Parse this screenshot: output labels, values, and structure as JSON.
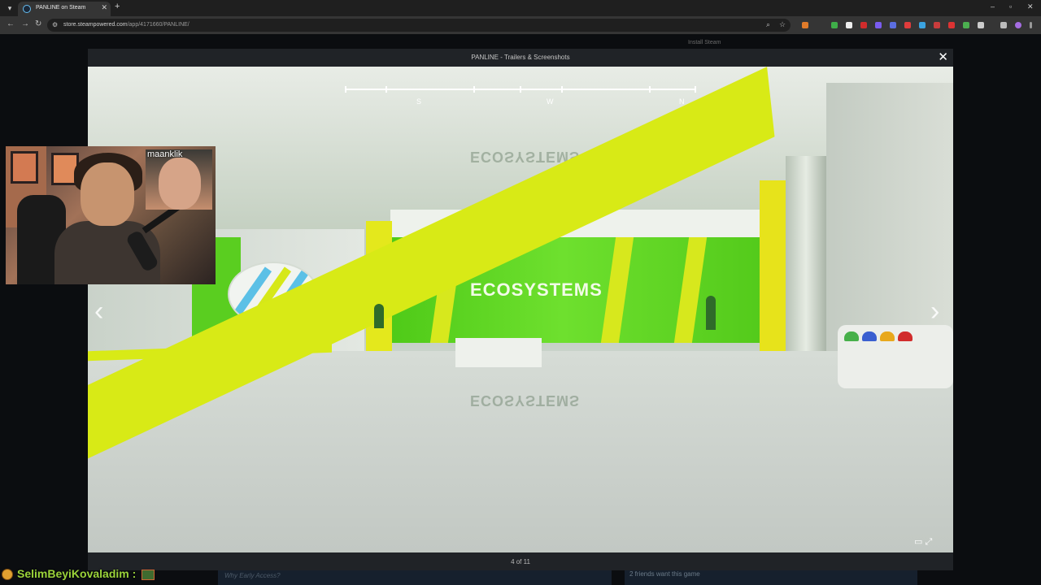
{
  "browser": {
    "tab_title": "PANLINE on Steam",
    "url_domain": "store.steampowered.com",
    "url_path": "/app/4171660/PANLINE/"
  },
  "page": {
    "install_steam": "Install Steam",
    "bottom_left_text": "Why Early Access?",
    "friends_text": "2 friends want this game"
  },
  "modal": {
    "title": "PANLINE - Trailers & Screenshots",
    "counter": "4 of 11"
  },
  "game_scene": {
    "compass": [
      "S",
      "W",
      "N"
    ],
    "sign_text": "ECOSYSTEMS"
  },
  "webcam": {
    "inset_name": "maanklik"
  },
  "chat": {
    "username": "SelimBeyiKovaladim :"
  },
  "colors": {
    "steam_dark": "#1b2838",
    "modal_bar": "#202327",
    "eco_green": "#58d11d",
    "eco_yellow": "#d8ea16",
    "chat_name": "#9bd33a"
  },
  "icons": {
    "prev": "chevron-left-icon",
    "next": "chevron-right-icon",
    "close": "close-icon",
    "fullscreen": "fullscreen-icon"
  }
}
